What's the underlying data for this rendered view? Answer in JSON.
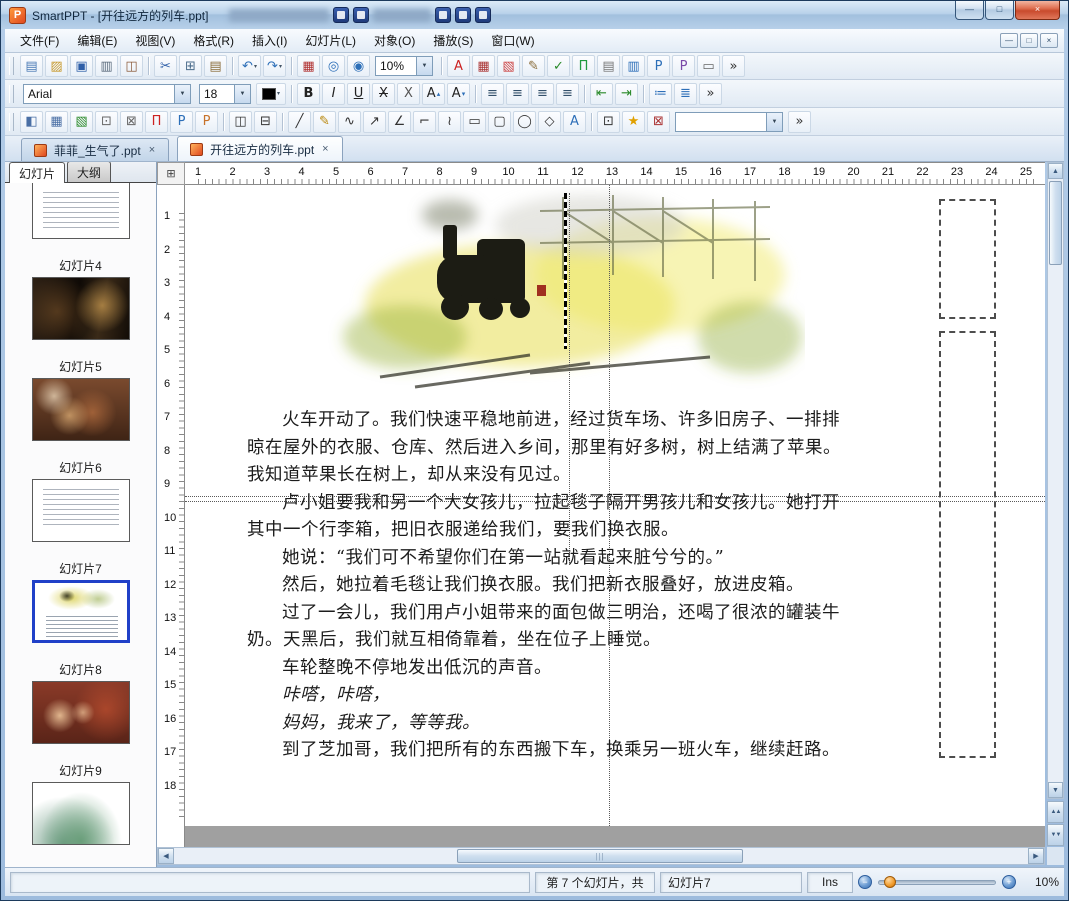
{
  "window": {
    "title": "SmartPPT - [开往远方的列车.ppt]",
    "logo_letter": "P",
    "caption": {
      "minimize": "—",
      "maximize": "□",
      "close": "×"
    }
  },
  "icons": {
    "arrow_up": "▲",
    "arrow_down": "▼",
    "arrow_left": "◀",
    "arrow_right": "▶",
    "double_up": "▲▲",
    "double_down": "▼▼",
    "grip": "|||",
    "corner": "⊞",
    "chevron": "▼"
  },
  "menu": {
    "items": [
      "文件(F)",
      "编辑(E)",
      "视图(V)",
      "格式(R)",
      "插入(I)",
      "幻灯片(L)",
      "对象(O)",
      "播放(S)",
      "窗口(W)"
    ]
  },
  "toolbars": {
    "row1": [
      {
        "name": "new-document",
        "glyph": "▤",
        "color": "#4a7ab5"
      },
      {
        "name": "open",
        "glyph": "▨",
        "color": "#c79a2e"
      },
      {
        "name": "save",
        "glyph": "▣",
        "color": "#2f5fa8"
      },
      {
        "name": "print",
        "glyph": "▥",
        "color": "#5a6b7c"
      },
      {
        "name": "print-preview",
        "glyph": "◫",
        "color": "#8a5a3a"
      },
      {
        "sep": true
      },
      {
        "name": "cut",
        "glyph": "✂",
        "color": "#2f5fa8"
      },
      {
        "name": "copy",
        "glyph": "⊞",
        "color": "#4a6b8a"
      },
      {
        "name": "paste",
        "glyph": "▤",
        "color": "#8a6d3b"
      },
      {
        "sep": true
      },
      {
        "name": "undo",
        "glyph": "↶",
        "color": "#2d6fb8",
        "dropdown": true
      },
      {
        "name": "redo",
        "glyph": "↷",
        "color": "#2d6fb8",
        "dropdown": true
      },
      {
        "sep": true
      },
      {
        "name": "format-painter",
        "glyph": "▦",
        "color": "#b03030"
      },
      {
        "name": "zoom-in",
        "glyph": "◎",
        "color": "#2d6fb8"
      },
      {
        "name": "zoom-selection",
        "glyph": "◉",
        "color": "#2d6fb8"
      },
      {
        "combo": "zoom",
        "value": "10%",
        "width": 58
      },
      {
        "sep": true
      },
      {
        "name": "font-color",
        "glyph": "A",
        "color": "#cc2222"
      },
      {
        "name": "insert-table",
        "glyph": "▦",
        "color": "#aa3333"
      },
      {
        "name": "slide-design",
        "glyph": "▧",
        "color": "#cc4444"
      },
      {
        "name": "edit-points",
        "glyph": "✎",
        "color": "#8a6d3b"
      },
      {
        "name": "spelling",
        "glyph": "✓",
        "color": "#2a8a2a"
      },
      {
        "name": "text-effects",
        "glyph": "Π",
        "color": "#1f9a3f"
      },
      {
        "name": "keyboard",
        "glyph": "▤",
        "color": "#777777"
      },
      {
        "name": "chart",
        "glyph": "▥",
        "color": "#2d6fb8"
      },
      {
        "name": "slide-properties",
        "glyph": "P",
        "color": "#2d6fb8"
      },
      {
        "name": "presentation-properties",
        "glyph": "P",
        "color": "#7a4aa8"
      },
      {
        "name": "play-settings",
        "glyph": "▭",
        "color": "#666666"
      },
      {
        "name": "toolbar-overflow",
        "glyph": "»",
        "color": "#333333"
      }
    ],
    "row2": [
      {
        "combo": "font-name",
        "value": "Arial",
        "width": 168
      },
      {
        "combo": "font-size",
        "value": "18",
        "width": 52
      },
      {
        "name": "font-color",
        "swatch": "#000000",
        "dropdown": true
      },
      {
        "sep": true
      },
      {
        "name": "bold",
        "glyph": "B",
        "color": "#222222",
        "cls": "g-bold"
      },
      {
        "name": "italic",
        "glyph": "I",
        "color": "#222222",
        "cls": "g-italic"
      },
      {
        "name": "underline",
        "glyph": "U",
        "color": "#222222",
        "cls": "g-und"
      },
      {
        "name": "strikethrough",
        "glyph": "X",
        "color": "#222222",
        "cls": "g-strike"
      },
      {
        "name": "shadow-text",
        "glyph": "X",
        "color": "#555555"
      },
      {
        "name": "grow-font",
        "glyph": "A",
        "color": "#222222",
        "badge": "▴",
        "badgeColor": "#2d6fb8"
      },
      {
        "name": "shrink-font",
        "glyph": "A",
        "color": "#222222",
        "badge": "▾",
        "badgeColor": "#2d6fb8"
      },
      {
        "sep": true
      },
      {
        "name": "align-left",
        "glyph": "≡",
        "color": "#33506b"
      },
      {
        "name": "align-center",
        "glyph": "≡",
        "color": "#33506b"
      },
      {
        "name": "align-right",
        "glyph": "≡",
        "color": "#33506b"
      },
      {
        "name": "justify",
        "glyph": "≡",
        "color": "#33506b"
      },
      {
        "sep": true
      },
      {
        "name": "decrease-indent",
        "glyph": "⇤",
        "color": "#2a8a2a"
      },
      {
        "name": "increase-indent",
        "glyph": "⇥",
        "color": "#2a8a2a"
      },
      {
        "sep": true
      },
      {
        "name": "bullets",
        "glyph": "≔",
        "color": "#2d6fb8"
      },
      {
        "name": "numbering",
        "glyph": "≣",
        "color": "#2d6fb8"
      },
      {
        "name": "toolbar-overflow",
        "glyph": "»",
        "color": "#333333"
      }
    ],
    "row3": [
      {
        "name": "insert-slide",
        "glyph": "◧",
        "color": "#4a6fa5"
      },
      {
        "name": "insert-table",
        "glyph": "▦",
        "color": "#4a6fa5"
      },
      {
        "name": "insert-picture",
        "glyph": "▧",
        "color": "#2a8a2a"
      },
      {
        "name": "insert-ole-object",
        "glyph": "⊡",
        "color": "#666666"
      },
      {
        "name": "insert-object",
        "glyph": "⊠",
        "color": "#666666"
      },
      {
        "name": "insert-formula",
        "glyph": "Π",
        "color": "#cc2222"
      },
      {
        "name": "insert-text-frame",
        "glyph": "P",
        "color": "#2d6fb8"
      },
      {
        "name": "insert-vertical-text",
        "glyph": "P",
        "color": "#c7722a"
      },
      {
        "sep": true
      },
      {
        "name": "layout-single",
        "glyph": "◫",
        "color": "#333333"
      },
      {
        "name": "layout-split",
        "glyph": "⊟",
        "color": "#333333"
      },
      {
        "sep": true
      },
      {
        "name": "draw-line",
        "glyph": "╱",
        "color": "#333333"
      },
      {
        "name": "draw-freehand",
        "glyph": "✎",
        "color": "#b8860b"
      },
      {
        "name": "draw-arc",
        "glyph": "∿",
        "color": "#333333"
      },
      {
        "name": "draw-arrow",
        "glyph": "↗",
        "color": "#333333"
      },
      {
        "name": "draw-polyline",
        "glyph": "∠",
        "color": "#333333"
      },
      {
        "name": "connector-elbow",
        "glyph": "⌐",
        "color": "#333333"
      },
      {
        "name": "connector-curved",
        "glyph": "≀",
        "color": "#333333"
      },
      {
        "name": "draw-rectangle",
        "glyph": "▭",
        "color": "#333333"
      },
      {
        "name": "draw-rounded-rectangle",
        "glyph": "▢",
        "color": "#333333"
      },
      {
        "name": "draw-ellipse",
        "glyph": "◯",
        "color": "#333333"
      },
      {
        "name": "draw-polygon",
        "glyph": "◇",
        "color": "#333333"
      },
      {
        "name": "insert-textbox",
        "glyph": "A",
        "color": "#2d6fb8"
      },
      {
        "sep": true
      },
      {
        "name": "crop",
        "glyph": "⊡",
        "color": "#333333"
      },
      {
        "name": "insert-star",
        "glyph": "★",
        "color": "#e0a000"
      },
      {
        "name": "delete-object",
        "glyph": "⊠",
        "color": "#aa3333"
      },
      {
        "combo": "object-style",
        "value": "",
        "width": 108
      },
      {
        "name": "toolbar-overflow",
        "glyph": "»",
        "color": "#333333"
      }
    ]
  },
  "doc_tabs": [
    {
      "label": "菲菲_生气了.ppt",
      "active": false
    },
    {
      "label": "开往远方的列车.ppt",
      "active": true
    }
  ],
  "sidebar": {
    "tabs": [
      {
        "label": "幻灯片",
        "active": true
      },
      {
        "label": "大纲",
        "active": false
      }
    ],
    "slides": [
      {
        "label": "",
        "art": "text-lines",
        "partial": "top"
      },
      {
        "label": "幻灯片4",
        "art": "dark-interior"
      },
      {
        "label": "幻灯片5",
        "art": "warm-figures"
      },
      {
        "label": "幻灯片6",
        "art": "text-lines"
      },
      {
        "label": "幻灯片7",
        "art": "story-page",
        "selected": true
      },
      {
        "label": "幻灯片8",
        "art": "red-interior"
      },
      {
        "label": "幻灯片9",
        "art": "green-art",
        "partial": "bottom"
      }
    ]
  },
  "rulers": {
    "h_ticks": 25,
    "v_ticks": 18
  },
  "slide": {
    "paragraphs": [
      {
        "text": "火车开动了。我们快速平稳地前进，经过货车场、许多旧房子、一排排晾在屋外的衣服、仓库、然后进入乡间，那里有好多树，树上结满了苹果。我知道苹果长在树上，却从来没有见过。"
      },
      {
        "text": "卢小姐要我和另一个大女孩儿，拉起毯子隔开男孩儿和女孩儿。她打开其中一个行李箱，把旧衣服递给我们，要我们换衣服。"
      },
      {
        "text": "她说：“我们可不希望你们在第一站就看起来脏兮兮的。”"
      },
      {
        "text": "然后，她拉着毛毯让我们换衣服。我们把新衣服叠好，放进皮箱。"
      },
      {
        "text": "过了一会儿，我们用卢小姐带来的面包做三明治，还喝了很浓的罐装牛奶。天黑后，我们就互相倚靠着，坐在位子上睡觉。"
      },
      {
        "text": "车轮整晚不停地发出低沉的声音。"
      },
      {
        "text": "咔嗒，咔嗒，",
        "italic": true
      },
      {
        "text": "妈妈，我来了，等等我。",
        "italic": true
      },
      {
        "text": "到了芝加哥，我们把所有的东西搬下车，换乘另一班火车，继续赶路。"
      }
    ]
  },
  "status": {
    "slide_info": "第 7 个幻灯片，共",
    "slide_name": "幻灯片7",
    "ins": "Ins",
    "zoom": "10%"
  },
  "colors": {
    "selection_accent": "#2040c8",
    "zoom_thumb": "#f09a2a",
    "close_button": "#c94a2d"
  }
}
